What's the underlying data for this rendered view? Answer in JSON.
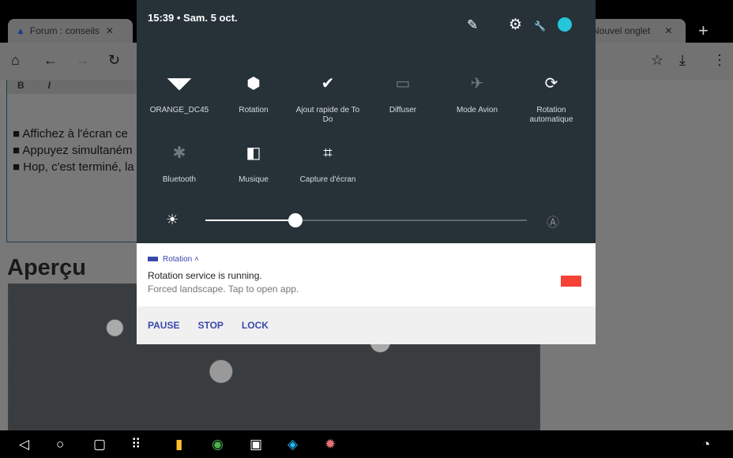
{
  "browser": {
    "tabs": [
      {
        "label": "Forum : conseils"
      },
      {
        "label": "Nouvel onglet"
      }
    ],
    "new_tab": "+"
  },
  "page": {
    "list": [
      "Affichez à l'écran ce",
      "Appuyez simultaném",
      "Hop, c'est terminé, la"
    ],
    "heading": "Aperçu",
    "format": [
      "B",
      "I"
    ]
  },
  "quick_settings": {
    "time": "15:39",
    "date": "Sam. 5 oct.",
    "tiles": [
      {
        "label": "ORANGE_DC45",
        "icon": "wifi-icon"
      },
      {
        "label": "Rotation",
        "icon": "rotation-icon"
      },
      {
        "label": "Ajout rapide de To Do",
        "icon": "check-icon"
      },
      {
        "label": "Diffuser",
        "icon": "cast-icon"
      },
      {
        "label": "Mode Avion",
        "icon": "airplane-icon"
      },
      {
        "label": "Rotation automatique",
        "icon": "auto-rotate-icon"
      },
      {
        "label": "Bluetooth",
        "icon": "bluetooth-icon"
      },
      {
        "label": "Musique",
        "icon": "dolby-icon"
      },
      {
        "label": "Capture d'écran",
        "icon": "crop-icon"
      }
    ],
    "brightness": 0.28
  },
  "notification": {
    "app": "Rotation",
    "title": "Rotation service is running.",
    "text": "Forced landscape. Tap to open app.",
    "actions": [
      "PAUSE",
      "STOP",
      "LOCK"
    ],
    "color": "#f44336"
  },
  "accent": "#3949ab"
}
